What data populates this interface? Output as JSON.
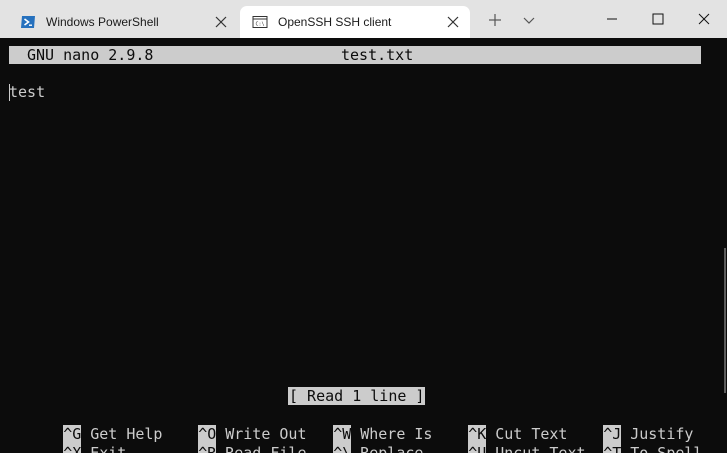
{
  "tabs": [
    {
      "label": "Windows PowerShell",
      "icon": "powershell-icon",
      "active": false
    },
    {
      "label": "OpenSSH SSH client",
      "icon": "terminal-window-icon",
      "active": true
    }
  ],
  "toolbar": {
    "new_tab_icon": "plus-icon",
    "dropdown_icon": "chevron-down-icon"
  },
  "window_controls": {
    "minimize_icon": "minimize-icon",
    "maximize_icon": "maximize-icon",
    "close_icon": "close-icon"
  },
  "nano": {
    "version": "GNU nano 2.9.8",
    "filename": "test.txt",
    "content_lines": [
      "test"
    ],
    "status_message": "[ Read 1 line ]",
    "shortcuts_row1": [
      {
        "key": "^G",
        "label": "Get Help"
      },
      {
        "key": "^O",
        "label": "Write Out"
      },
      {
        "key": "^W",
        "label": "Where Is"
      },
      {
        "key": "^K",
        "label": "Cut Text"
      },
      {
        "key": "^J",
        "label": "Justify"
      }
    ],
    "shortcuts_row2": [
      {
        "key": "^X",
        "label": "Exit"
      },
      {
        "key": "^R",
        "label": "Read File"
      },
      {
        "key": "^\\",
        "label": "Replace"
      },
      {
        "key": "^U",
        "label": "Uncut Text"
      },
      {
        "key": "^T",
        "label": "To Spell"
      }
    ]
  },
  "colors": {
    "terminal_bg": "#0c0c0c",
    "terminal_fg": "#cccccc",
    "tabbar_bg": "#e3e3e3",
    "powershell_blue": "#2671be"
  }
}
